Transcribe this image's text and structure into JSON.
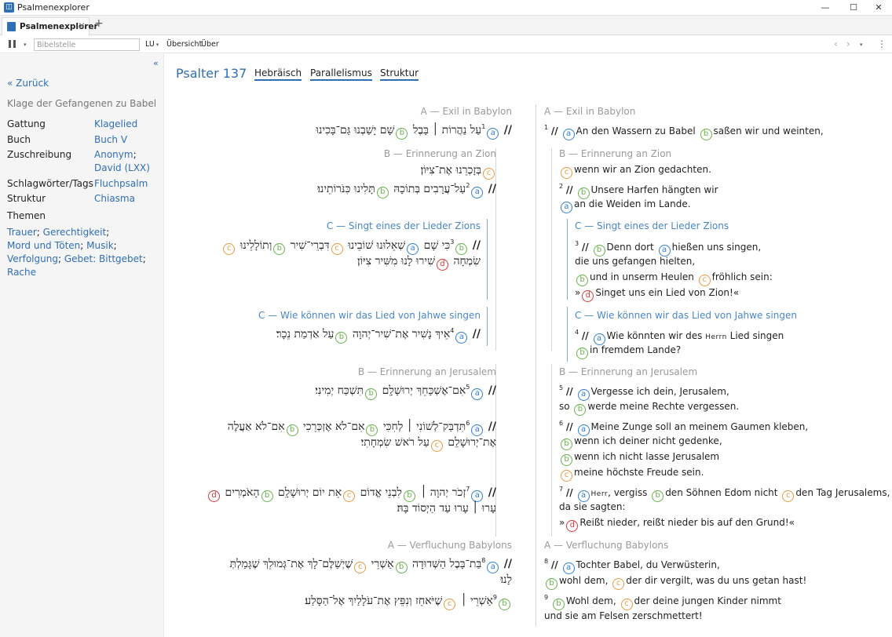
{
  "window": {
    "title": "Psalmenexplorer",
    "min": "—",
    "max": "☐",
    "close": "✕"
  },
  "tabbar": {
    "tab_label": "Psalmenexplorer",
    "close": "✕",
    "add": "+"
  },
  "toolbar": {
    "bibelstelle_placeholder": "Bibelstelle",
    "translation": "LU",
    "overview": "Übersicht",
    "about": "Über",
    "caret": "▾",
    "prev": "‹",
    "next": "›",
    "more": "⋮"
  },
  "sidebar": {
    "collapse": "«",
    "back": "« Zurück",
    "subtitle": "Klage der Gefangenen zu Babel",
    "rows": {
      "gattung": {
        "label": "Gattung",
        "value": "Klagelied"
      },
      "buch": {
        "label": "Buch",
        "value": "Buch V"
      },
      "zuschreibung": {
        "label": "Zuschreibung",
        "value1": "Anonym",
        "value2": "David (LXX)",
        "sep": ";"
      },
      "schlag": {
        "label": "Schlagwörter/Tags",
        "value": "Fluchpsalm"
      },
      "struktur": {
        "label": "Struktur",
        "value": "Chiasma"
      }
    },
    "themen_label": "Themen",
    "themen": [
      "Trauer",
      "Gerechtigkeit",
      "Mord und Töten",
      "Musik",
      "Verfolgung",
      "Gebet: Bittgebet",
      "Rache"
    ],
    "themen_sep": "; "
  },
  "main": {
    "title": "Psalter 137",
    "tabs": [
      "Hebräisch",
      "Parallelismus",
      "Struktur"
    ],
    "sections": {
      "a1": "A — Exil in Babylon",
      "b1": "B — Erinnerung an Zion",
      "c1": "C — Singt eines der Lieder Zions",
      "c2": "C — Wie können wir das Lied von Jahwe singen",
      "b2": "B — Erinnerung an Jerusalem",
      "a2": "A — Verfluchung Babylons"
    },
    "colon_labels": {
      "a": "a",
      "b": "b",
      "c": "c",
      "d": "d"
    },
    "slash": "//",
    "verse_numbers": [
      "1",
      "2",
      "3",
      "4",
      "5",
      "6",
      "7",
      "8",
      "9"
    ],
    "hebrew": {
      "v1a": "עַל נַהֲרוֹת ׀ בָּבֶל",
      "v1b": "שָׁם יָשַׁבְנוּ גַּם־בָּכִינוּ",
      "v1c": "בְּזָכְרֵנוּ אֶת־צִיּוֹן׃",
      "v2a": "עַל־עֲרָבִים בְּתוֹכָהּ",
      "v2b": "תָּלִינוּ כִּנֹּרוֹתֵינוּ׃",
      "v3b1": "כִּי שָׁם",
      "v3a": "שְׁאֵלוּנוּ שׁוֹבֵינוּ",
      "v3c1": "דִּבְרֵי־שִׁיר",
      "v3b2": "וְתוֹלָלֵינוּ",
      "v3c2": "שִׂמְחָה",
      "v3d": "שִׁירוּ לָנוּ מִשִּׁיר צִיּוֹן׃",
      "v4a": "אֵיךְ נָשִׁיר אֶת־שִׁיר־יְהוָה",
      "v4b": "עַל אַדְמַת נֵכָר׃",
      "v5a": "אִם־אֶשְׁכָּחֵךְ יְרוּשָׁלִָם",
      "v5b": "תִּשְׁכַּח יְמִינִי׃",
      "v6a": "תִּדְבַּק־לְשׁוֹנִי ׀ לְחִכִּי",
      "v6b1": "אִם־לֹא אֶזְכְּרֵכִי",
      "v6b2": "אִם־לֹא אַעֲלֶה",
      "v6c": "אֶת־יְרוּשָׁלִַם",
      "v6c2": "עַל רֹאשׁ שִׂמְחָתִי׃",
      "v7a": "זְכֹר יְהוָה ׀",
      "v7b": "לִבְנֵי אֱדוֹם",
      "v7c": "אֵת יוֹם יְרוּשָׁלִָם",
      "v7d1": "הָאֹמְרִים",
      "v7d2": "עָרוּ ׀ עָרוּ עַד הַיְסוֹד בָּהּ׃",
      "v8a": "בַּת־בָּבֶל הַשְּׁדוּדָה",
      "v8b": "אַשְׁרֵי",
      "v8c": "שֶׁיְשַׁלֶּם־לָךְ אֶת־גְּמוּלֵךְ שֶׁגָּמַלְתְּ",
      "v8c2": "לָנוּ׃",
      "v9b": "אַשְׁרֵי ׀",
      "v9c": "שֶׁיֹּאחֵז וְנִפֵּץ אֶת־עֹלָלַיִךְ אֶל־הַסָּלַע׃"
    },
    "german": {
      "v1a": "An den Wassern zu Babel",
      "v1b": "saßen wir und weinten,",
      "v1c": "wenn wir an Zion gedachten.",
      "v2b": "Unsere Harfen hängten wir",
      "v2a": "an die Weiden im Lande.",
      "v3b1": "Denn dort",
      "v3a1": "hießen uns singen,",
      "v3a2": "die uns gefangen hielten,",
      "v3b2": "und in unserm Heulen",
      "v3c": "fröhlich sein:",
      "v3d_pre": "»",
      "v3d": "Singet uns ein Lied von Zion!«",
      "v4a1": "Wie könnten wir des",
      "v4a_herr": "Herrn",
      "v4a2": "Lied singen",
      "v4b": "in fremdem Lande?",
      "v5a": "Vergesse ich dein, Jerusalem,",
      "v5pre": "so",
      "v5b": "werde meine Rechte vergessen.",
      "v6a": "Meine Zunge soll an meinem Gaumen kleben,",
      "v6b1": "wenn ich deiner nicht gedenke,",
      "v6b2": "wenn ich nicht lasse Jerusalem",
      "v6c": "meine höchste Freude sein.",
      "v7a_herr": "Herr",
      "v7a": ", vergiss",
      "v7b": "den Söhnen Edom nicht",
      "v7c": "den Tag Jerusalems,",
      "v7c2": "da sie sagten:",
      "v7d_pre": "»",
      "v7d": "Reißt nieder, reißt nieder bis auf den Grund!«",
      "v8a": "Tochter Babel, du Verwüsterin,",
      "v8b": "wohl dem,",
      "v8c": "der dir vergilt, was du uns getan hast!",
      "v9b": "Wohl dem,",
      "v9c": "der deine jungen Kinder nimmt",
      "v9c2": "und sie am Felsen zerschmettert!"
    }
  }
}
